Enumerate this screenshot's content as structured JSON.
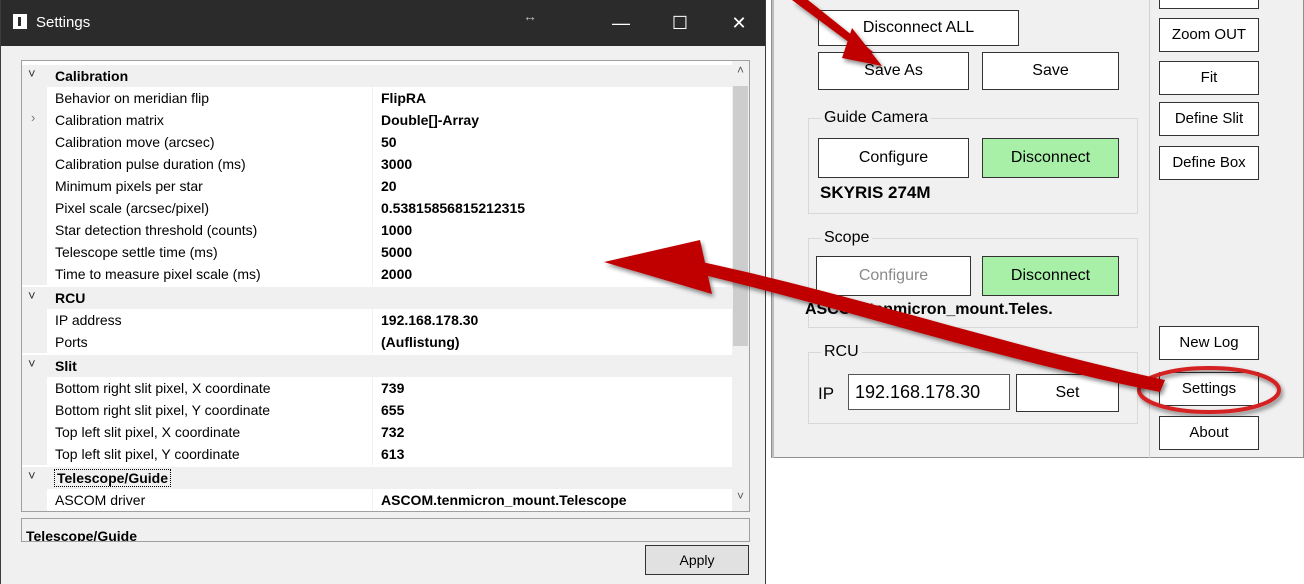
{
  "settings_window": {
    "title": "Settings",
    "resize_glyph": "↔",
    "minimize_glyph": "—",
    "maximize_glyph": "☐",
    "close_glyph": "✕",
    "scroll_up_glyph": "˄",
    "scroll_down_glyph": "˅",
    "categories": {
      "calibration": {
        "name": "Calibration",
        "toggle": "˅",
        "rows": [
          {
            "name": "Behavior on meridian flip",
            "value": "FlipRA"
          },
          {
            "name": "Calibration matrix",
            "value": "Double[]-Array",
            "expander": "›"
          },
          {
            "name": "Calibration move (arcsec)",
            "value": "50"
          },
          {
            "name": "Calibration pulse duration (ms)",
            "value": "3000"
          },
          {
            "name": "Minimum pixels per star",
            "value": "20"
          },
          {
            "name": "Pixel scale (arcsec/pixel)",
            "value": "0.53815856815212315"
          },
          {
            "name": "Star detection threshold (counts)",
            "value": "1000"
          },
          {
            "name": "Telescope settle time (ms)",
            "value": "5000"
          },
          {
            "name": "Time to measure pixel scale (ms)",
            "value": "2000"
          }
        ]
      },
      "rcu": {
        "name": "RCU",
        "toggle": "˅",
        "rows": [
          {
            "name": "IP address",
            "value": "192.168.178.30"
          },
          {
            "name": "Ports",
            "value": "(Auflistung)"
          }
        ]
      },
      "slit": {
        "name": "Slit",
        "toggle": "˅",
        "rows": [
          {
            "name": "Bottom right slit pixel, X coordinate",
            "value": "739"
          },
          {
            "name": "Bottom right slit pixel, Y coordinate",
            "value": "655"
          },
          {
            "name": "Top left slit pixel, X coordinate",
            "value": "732"
          },
          {
            "name": "Top left slit pixel, Y coordinate",
            "value": "613"
          }
        ]
      },
      "telescope": {
        "name": "Telescope/Guide",
        "toggle": "˅",
        "rows": [
          {
            "name": "ASCOM driver",
            "value": "ASCOM.tenmicron_mount.Telescope"
          }
        ]
      }
    },
    "description_title": "Telescope/Guide",
    "apply_label": "Apply"
  },
  "main_panel": {
    "disconnect_all_label": "Disconnect ALL",
    "save_as_label": "Save As",
    "save_label": "Save",
    "guide_camera": {
      "group_label": "Guide Camera",
      "configure_label": "Configure",
      "disconnect_label": "Disconnect",
      "camera_name": "SKYRIS 274M"
    },
    "scope": {
      "group_label": "Scope",
      "configure_label": "Configure",
      "disconnect_label": "Disconnect",
      "driver_name": "ASCOM.tenmicron_mount.Teles."
    },
    "rcu": {
      "group_label": "RCU",
      "ip_label": "IP",
      "ip_value": "192.168.178.30",
      "set_label": "Set"
    },
    "right_buttons": {
      "zoom_out": "Zoom OUT",
      "fit": "Fit",
      "define_slit": "Define Slit",
      "define_box": "Define Box",
      "new_log": "New Log",
      "settings": "Settings",
      "about": "About"
    }
  },
  "annotation_colors": {
    "arrow": "#c00000",
    "highlight_ring": "#d42020"
  }
}
